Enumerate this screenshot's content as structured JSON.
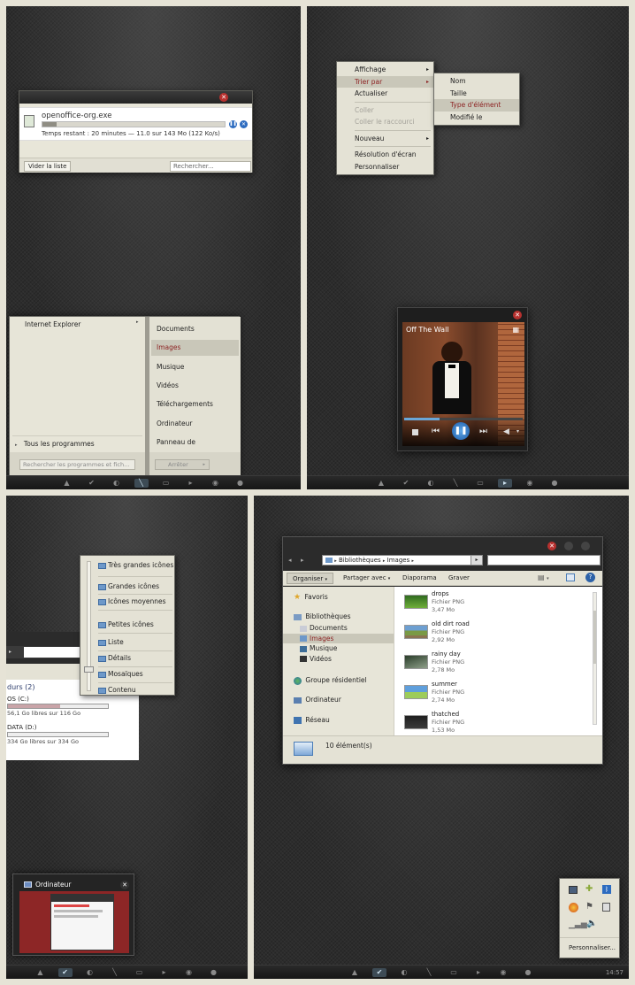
{
  "download": {
    "filename": "openoffice-org.exe",
    "status": "Temps restant : 20 minutes — 11.0 sur 143 Mo (122 Ko/s)",
    "progress": 0.08,
    "clear_button": "Vider la liste",
    "search_placeholder": "Rechercher..."
  },
  "start_menu": {
    "pinned": [
      "Internet Explorer"
    ],
    "all_programs": "Tous les programmes",
    "search_placeholder": "Rechercher les programmes et fich...",
    "right_items": [
      "Documents",
      "Images",
      "Musique",
      "Vidéos",
      "Téléchargements",
      "Ordinateur",
      "Panneau de configuration"
    ],
    "selected_right": "Images",
    "shutdown": "Arrêter"
  },
  "context_menu": {
    "items": [
      {
        "label": "Affichage",
        "sub": true,
        "state": "normal"
      },
      {
        "label": "Trier par",
        "sub": true,
        "state": "highlight"
      },
      {
        "label": "Actualiser",
        "sub": false,
        "state": "normal"
      },
      {
        "sep": true
      },
      {
        "label": "Coller",
        "sub": false,
        "state": "disabled"
      },
      {
        "label": "Coller le raccourci",
        "sub": false,
        "state": "disabled"
      },
      {
        "sep": true
      },
      {
        "label": "Nouveau",
        "sub": true,
        "state": "normal"
      },
      {
        "sep": true
      },
      {
        "label": "Résolution d'écran",
        "sub": false,
        "state": "normal"
      },
      {
        "label": "Personnaliser",
        "sub": false,
        "state": "normal"
      }
    ],
    "submenu": [
      "Nom",
      "Taille",
      "Type d'élément",
      "Modifié le"
    ],
    "submenu_selected": "Type d'élément"
  },
  "media_player": {
    "title": "Off The Wall"
  },
  "view_menu": {
    "items": [
      "Très grandes icônes",
      "Grandes icônes",
      "Icônes moyennes",
      "Petites icônes",
      "Liste",
      "Détails",
      "Mosaïques",
      "Contenu"
    ],
    "drives_header": "durs (2)",
    "drives": [
      {
        "name": "OS (C:)",
        "free": "56,1 Go libres sur 116 Go",
        "fill": 0.52,
        "color": "#c9a4a8"
      },
      {
        "name": "DATA (D:)",
        "free": "334 Go libres sur 334 Go",
        "fill": 0.0,
        "color": "#c9a4a8"
      }
    ]
  },
  "thumbnail": {
    "title": "Ordinateur"
  },
  "explorer": {
    "breadcrumb": [
      "Bibliothèques",
      "Images"
    ],
    "toolbar": [
      "Organiser",
      "Partager avec",
      "Diaporama",
      "Graver"
    ],
    "nav": {
      "favorites": "Favoris",
      "libraries": "Bibliothèques",
      "lib_items": [
        "Documents",
        "Images",
        "Musique",
        "Vidéos"
      ],
      "homegroup": "Groupe résidentiel",
      "computer": "Ordinateur",
      "network": "Réseau"
    },
    "files": [
      {
        "name": "drops",
        "type": "Fichier PNG",
        "size": "3,47 Mo",
        "thumb": "green"
      },
      {
        "name": "old dirt road",
        "type": "Fichier PNG",
        "size": "2,92 Mo",
        "thumb": "road"
      },
      {
        "name": "rainy day",
        "type": "Fichier PNG",
        "size": "2,78 Mo",
        "thumb": "rain"
      },
      {
        "name": "summer",
        "type": "Fichier PNG",
        "size": "2,74 Mo",
        "thumb": "summer"
      },
      {
        "name": "thatched",
        "type": "Fichier PNG",
        "size": "1,53 Mo",
        "thumb": "dark"
      }
    ],
    "count": "10 élément(s)"
  },
  "tray": {
    "customize": "Personnaliser..."
  },
  "clock": "14:57",
  "accent": "#8d2222"
}
